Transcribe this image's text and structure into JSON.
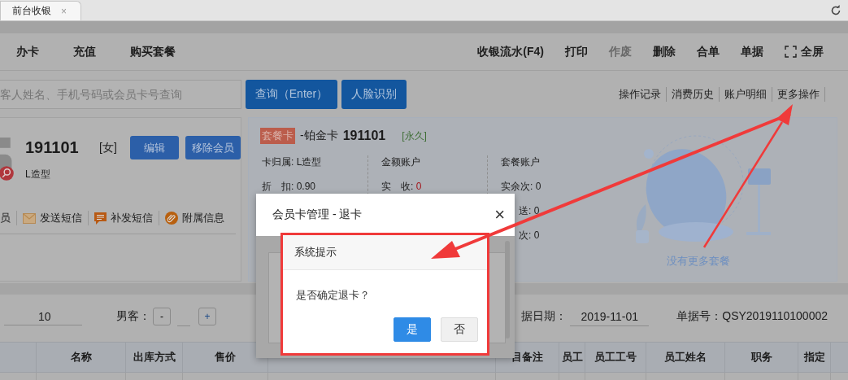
{
  "browser": {
    "tab": {
      "title": "前台收银",
      "close": "×"
    }
  },
  "toolbar": {
    "left": [
      {
        "label": "办卡"
      },
      {
        "label": "充值"
      },
      {
        "label": "购买套餐"
      }
    ],
    "right": [
      {
        "label": "收银流水(F4)",
        "disabled": false,
        "kind": "text"
      },
      {
        "label": "打印",
        "disabled": false,
        "kind": "text"
      },
      {
        "label": "作废",
        "disabled": true,
        "kind": "text"
      },
      {
        "label": "删除",
        "disabled": false,
        "kind": "text"
      },
      {
        "label": "合单",
        "disabled": false,
        "kind": "text"
      },
      {
        "label": "单据",
        "disabled": false,
        "kind": "text"
      },
      {
        "label": "全屏",
        "disabled": false,
        "kind": "fullscreen"
      }
    ]
  },
  "search": {
    "placeholder": "客人姓名、手机号码或会员卡号查询",
    "buttons": [
      "查询（Enter）",
      "人脸识别"
    ],
    "links": [
      "操作记录",
      "消费历史",
      "账户明细",
      "更多操作"
    ]
  },
  "member": {
    "name": "191101",
    "gender": "[女]",
    "buttons": [
      "编辑",
      "移除会员"
    ],
    "store": "L造型",
    "actions": [
      {
        "label": "员",
        "kind": "plain"
      },
      {
        "label": "发送短信",
        "kind": "mail"
      },
      {
        "label": "补发短信",
        "kind": "chat"
      },
      {
        "label": "附属信息",
        "kind": "attach"
      }
    ]
  },
  "card": {
    "badge": "套餐卡",
    "type": "-铂金卡",
    "number": "191101",
    "validity": "[永久]",
    "columns": [
      {
        "rows": [
          {
            "label": "卡归属: L造型"
          },
          {
            "label": "折　扣: 0.90"
          }
        ]
      },
      {
        "rows": [
          {
            "label": "金额账户"
          },
          {
            "label": "实　收: ",
            "value": "0"
          }
        ]
      },
      {
        "rows": [
          {
            "label": "套餐账户"
          },
          {
            "label": "实余次: 0"
          },
          {
            "label": "送: 0"
          },
          {
            "label": "次: 0"
          }
        ]
      }
    ],
    "empty_text": "没有更多套餐"
  },
  "order": {
    "count": "10",
    "male_label": "男客：",
    "minus": "-",
    "plus": "+",
    "date_label": "据日期：",
    "date": "2019-11-01",
    "number_label": "单据号：QSY2019110100002"
  },
  "table": {
    "columns": [
      "",
      "名称",
      "出库方式",
      "售价",
      "",
      "目备注",
      "员工",
      "员工工号",
      "员工姓名",
      "职务",
      "指定"
    ]
  },
  "dialog": {
    "title": "会员卡管理 - 退卡",
    "close": "×"
  },
  "confirm": {
    "title": "系统提示",
    "message": "是否确定退卡？",
    "buttons": [
      {
        "label": "是",
        "primary": true
      },
      {
        "label": "否",
        "primary": false
      }
    ]
  }
}
